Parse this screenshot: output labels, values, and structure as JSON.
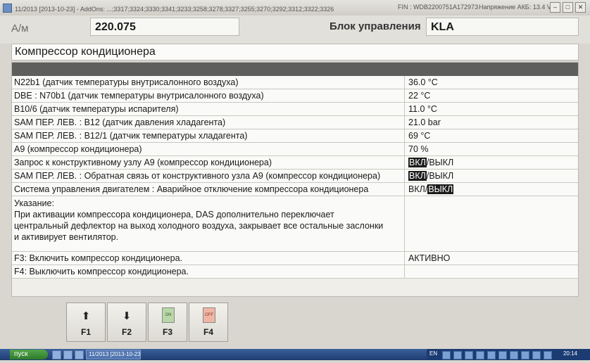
{
  "titlebar": {
    "left_text": "11/2013 [2013-10-23] - AddOns: ...;3317;3324;3330;3341;3233;3258;3278;3327;3255;3270;3292;3312;3322;3326",
    "fin": "FIN : WDB2200751A172973",
    "battery": "Напряжение АКБ: 13.4 V"
  },
  "header": {
    "am_label": "А/м",
    "am_value": "220.075",
    "control_unit_label": "Блок управления",
    "control_unit_value": "KLA"
  },
  "section_title": "Компрессор кондиционера",
  "rows": [
    {
      "name": "N22b1 (датчик температуры внутрисалонного воздуха)",
      "value": "36.0 °C"
    },
    {
      "name": "DBE : N70b1 (датчик температуры внутрисалонного воздуха)",
      "value": "22 °C"
    },
    {
      "name": "B10/6 (датчик температуры испарителя)",
      "value": "11.0 °C"
    },
    {
      "name": "SAM ПЕР. ЛЕВ. : B12 (датчик давления хладагента)",
      "value": "21.0 bar"
    },
    {
      "name": "SAM ПЕР. ЛЕВ. : B12/1 (датчик температуры хладагента)",
      "value": "69 °C"
    },
    {
      "name": "A9 (компрессор кондиционера)",
      "value": "70 %"
    }
  ],
  "switch_rows": [
    {
      "name": "Запрос к конструктивному узлу A9 (компрессор кондиционера)",
      "on": "ВКЛ",
      "sep": "/",
      "off": "ВЫКЛ",
      "selected": "on"
    },
    {
      "name": "SAM ПЕР. ЛЕВ. : Обратная связь от конструктивного узла A9 (компрессор кондиционера)",
      "on": "ВКЛ",
      "sep": "/",
      "off": "ВЫКЛ",
      "selected": "on"
    },
    {
      "name": "Система управления двигателем : Аварийное отключение компрессора кондиционера",
      "on": "ВКЛ",
      "sep": "/",
      "off": "ВЫКЛ",
      "selected": "off"
    }
  ],
  "note": {
    "title": "Указание:",
    "lines": [
      "При активации компрессора кондиционера, DAS дополнительно переключает",
      "центральный дефлектор на выход холодного воздуха, закрывает все остальные заслонки",
      "и активирует вентилятор."
    ]
  },
  "actions": [
    {
      "text": "F3: Включить компрессор кондиционера.",
      "status": "АКТИВНО"
    },
    {
      "text": "F4: Выключить компрессор кондиционера.",
      "status": ""
    }
  ],
  "fkeys": [
    {
      "label": "F1",
      "icon": "arrow-up-icon",
      "glyph": "🡅"
    },
    {
      "label": "F2",
      "icon": "arrow-down-icon",
      "glyph": "🡇"
    },
    {
      "label": "F3",
      "icon": "switch-on-icon",
      "glyph": "ON"
    },
    {
      "label": "F4",
      "icon": "switch-off-icon",
      "glyph": "OFF"
    }
  ],
  "taskbar": {
    "start": "пуск",
    "task": "11/2013 [2013-10-23...",
    "lang": "EN",
    "clock": "20:14"
  },
  "colors": {
    "selected_bg": "#1c1c1c",
    "header_bar": "#5e5e5c",
    "taskbar": "#1f3d72",
    "start": "#2e7a2a"
  }
}
